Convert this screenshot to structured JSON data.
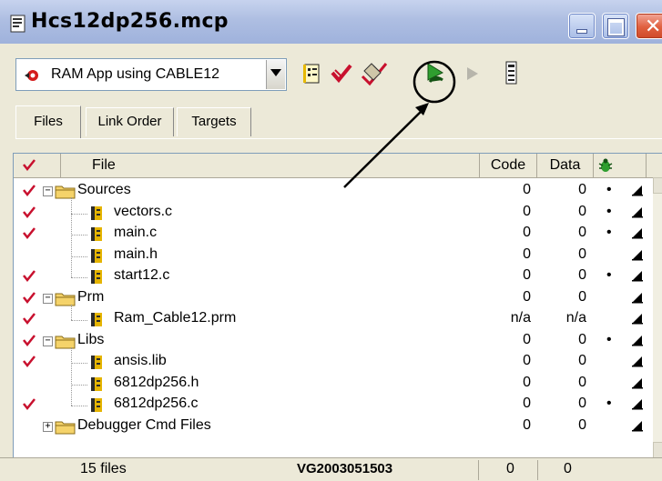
{
  "window": {
    "title": "Hcs12dp256.mcp",
    "title_icon": "project-file-icon",
    "controls": [
      "minimize-icon",
      "maximize-icon",
      "close-icon"
    ]
  },
  "toolbar": {
    "target_value": "RAM App using CABLE12",
    "target_icon": "target-icon",
    "tools": [
      "settings-icon",
      "check-icon",
      "compile-icon",
      "make-icon",
      "run-icon",
      "debug-panel-icon"
    ]
  },
  "tabs": [
    {
      "label": "Files",
      "active": true
    },
    {
      "label": "Link Order",
      "active": false
    },
    {
      "label": "Targets",
      "active": false
    }
  ],
  "columns": {
    "file": "File",
    "code": "Code",
    "data": "Data",
    "debug_icon": "bug-icon"
  },
  "rows": [
    {
      "name": "Sources",
      "level": 0,
      "type": "folder",
      "expander": "−",
      "checked": true,
      "code": "0",
      "data": "0",
      "dot": "•"
    },
    {
      "name": "vectors.c",
      "level": 1,
      "type": "file",
      "checked": true,
      "code": "0",
      "data": "0",
      "dot": "•"
    },
    {
      "name": "main.c",
      "level": 1,
      "type": "file",
      "checked": true,
      "code": "0",
      "data": "0",
      "dot": "•"
    },
    {
      "name": "main.h",
      "level": 1,
      "type": "file",
      "checked": false,
      "code": "0",
      "data": "0",
      "dot": ""
    },
    {
      "name": "start12.c",
      "level": 1,
      "type": "file",
      "checked": true,
      "code": "0",
      "data": "0",
      "dot": "•"
    },
    {
      "name": "Prm",
      "level": 0,
      "type": "folder",
      "expander": "−",
      "checked": true,
      "code": "0",
      "data": "0",
      "dot": ""
    },
    {
      "name": "Ram_Cable12.prm",
      "level": 1,
      "type": "file",
      "checked": true,
      "code": "n/a",
      "data": "n/a",
      "dot": ""
    },
    {
      "name": "Libs",
      "level": 0,
      "type": "folder",
      "expander": "−",
      "checked": true,
      "code": "0",
      "data": "0",
      "dot": "•"
    },
    {
      "name": "ansis.lib",
      "level": 1,
      "type": "file",
      "checked": true,
      "code": "0",
      "data": "0",
      "dot": ""
    },
    {
      "name": "6812dp256.h",
      "level": 1,
      "type": "file",
      "checked": false,
      "code": "0",
      "data": "0",
      "dot": ""
    },
    {
      "name": "6812dp256.c",
      "level": 1,
      "type": "file",
      "checked": true,
      "code": "0",
      "data": "0",
      "dot": "•"
    },
    {
      "name": "Debugger Cmd Files",
      "level": 0,
      "type": "folder",
      "expander": "+",
      "checked": false,
      "code": "0",
      "data": "0",
      "dot": ""
    }
  ],
  "status": {
    "files": "15 files",
    "id": "VG2003051503",
    "code": "0",
    "data": "0"
  },
  "colors": {
    "check_red": "#c8102e",
    "folder_yellow": "#f5d36a",
    "accent_green": "#2f9e2f"
  }
}
